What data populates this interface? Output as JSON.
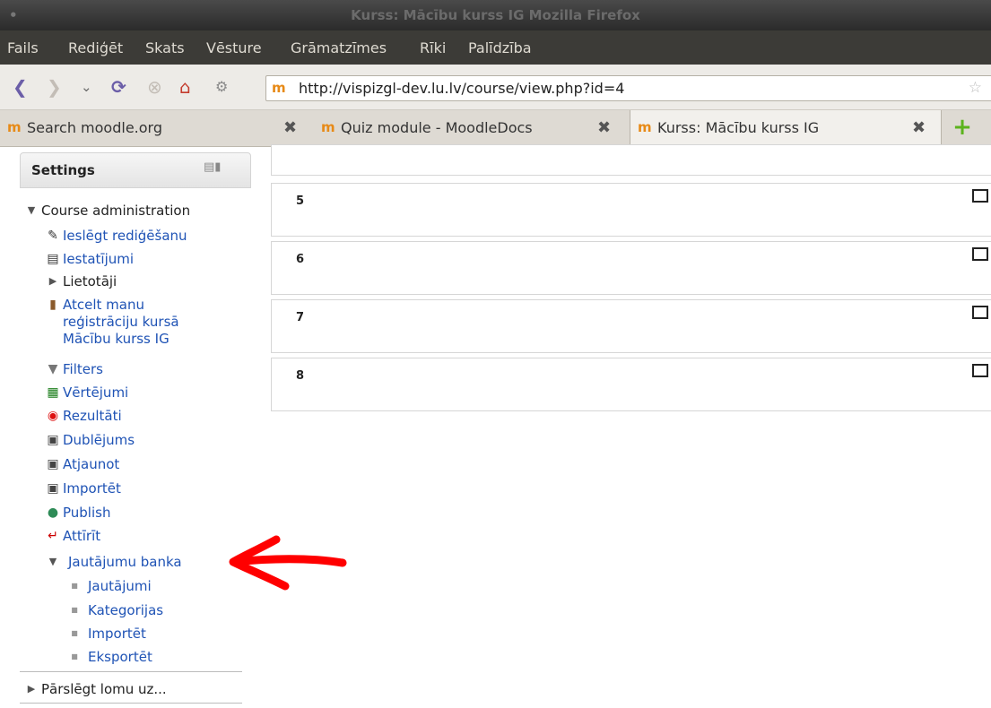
{
  "window": {
    "title": "Kurss: Mācību kurss IG Mozilla Firefox"
  },
  "menu": [
    "Fails",
    "Rediģēt",
    "Skats",
    "Vēsture",
    "Grāmatzīmes",
    "Rīki",
    "Palīdzība"
  ],
  "navigation": {
    "url": "http://vispizgl-dev.lu.lv/course/view.php?id=4"
  },
  "tabs": [
    {
      "label": "Search moodle.org",
      "icon": "moodle-icon"
    },
    {
      "label": "Quiz module - MoodleDocs",
      "icon": "moodle-docs-icon"
    },
    {
      "label": "Kurss: Mācību kurss IG",
      "icon": "moodle-docs-icon",
      "active": true
    }
  ],
  "sidebar": {
    "title": "Settings",
    "course_admin": "Course administration",
    "items": [
      {
        "label": "Ieslēgt rediģēšanu",
        "icon": "edit-icon"
      },
      {
        "label": "Iestatījumi",
        "icon": "settings-doc-icon"
      },
      {
        "label": "Lietotāji",
        "icon": "expand-arrow-icon"
      },
      {
        "label": "Atcelt manu reģistrāciju kursā Mācību kurss IG",
        "lines": [
          "Atcelt manu",
          "reģistrāciju kursā",
          "Mācību kurss IG"
        ],
        "icon": "door-icon"
      },
      {
        "label": "Filters",
        "icon": "filter-icon"
      },
      {
        "label": "Vērtējumi",
        "icon": "grades-icon"
      },
      {
        "label": "Rezultāti",
        "icon": "outcomes-icon"
      },
      {
        "label": "Dublējums",
        "icon": "backup-icon"
      },
      {
        "label": "Atjaunot",
        "icon": "restore-icon"
      },
      {
        "label": "Importēt",
        "icon": "import-icon"
      },
      {
        "label": "Publish",
        "icon": "publish-icon"
      },
      {
        "label": "Attīrīt",
        "icon": "reset-icon"
      }
    ],
    "question_bank": {
      "label": "Jautājumu banka",
      "children": [
        "Jautājumi",
        "Kategorijas",
        "Importēt",
        "Eksportēt"
      ]
    },
    "switch_role": "Pārslēgt lomu uz..."
  },
  "sections": [
    "5",
    "6",
    "7",
    "8"
  ],
  "colors": {
    "link": "#1f53b5",
    "annotation_arrow": "#ff0000",
    "menubar": "#3c3b37"
  }
}
